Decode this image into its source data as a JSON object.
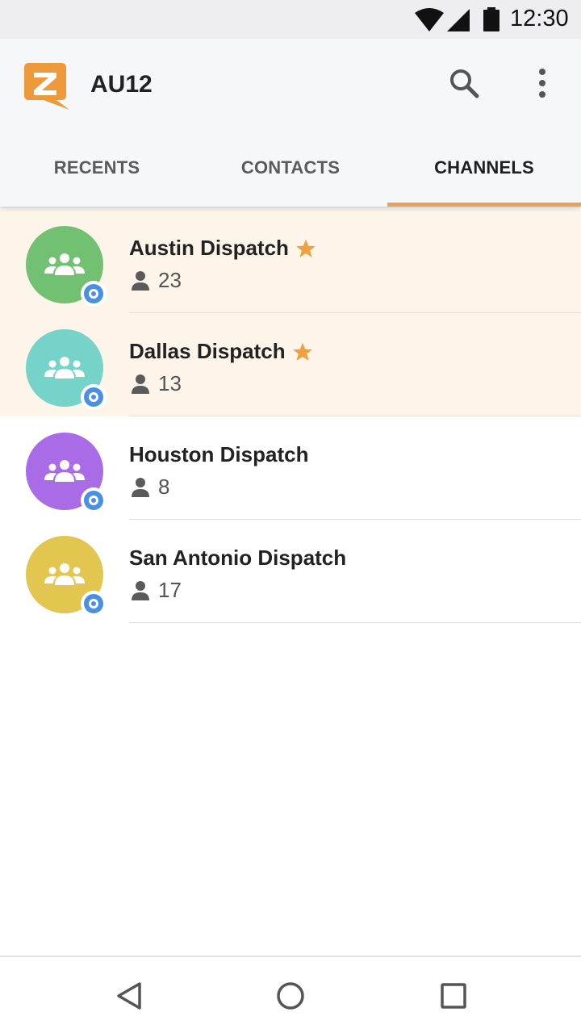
{
  "status_bar": {
    "time": "12:30"
  },
  "app_bar": {
    "title": "AU12"
  },
  "tabs": [
    {
      "label": "RECENTS",
      "active": false
    },
    {
      "label": "CONTACTS",
      "active": false
    },
    {
      "label": "CHANNELS",
      "active": true
    }
  ],
  "channels": [
    {
      "name": "Austin Dispatch",
      "members": "23",
      "favorite": true,
      "color": "#72c072"
    },
    {
      "name": "Dallas Dispatch",
      "members": "13",
      "favorite": true,
      "color": "#75d3ca"
    },
    {
      "name": "Houston Dispatch",
      "members": "8",
      "favorite": false,
      "color": "#a96be6"
    },
    {
      "name": "San Antonio Dispatch",
      "members": "17",
      "favorite": false,
      "color": "#e3c64f"
    }
  ],
  "colors": {
    "accent": "#f0a050",
    "favorite_bg": "#fdf5ea",
    "badge": "#4a90e2",
    "logo": "#ee9a3a"
  },
  "icons": [
    "wifi-icon",
    "signal-icon",
    "battery-icon",
    "app-logo",
    "search-icon",
    "more-vert-icon",
    "group-icon",
    "status-badge-icon",
    "star-icon",
    "person-icon",
    "back-icon",
    "home-icon",
    "recents-icon"
  ]
}
